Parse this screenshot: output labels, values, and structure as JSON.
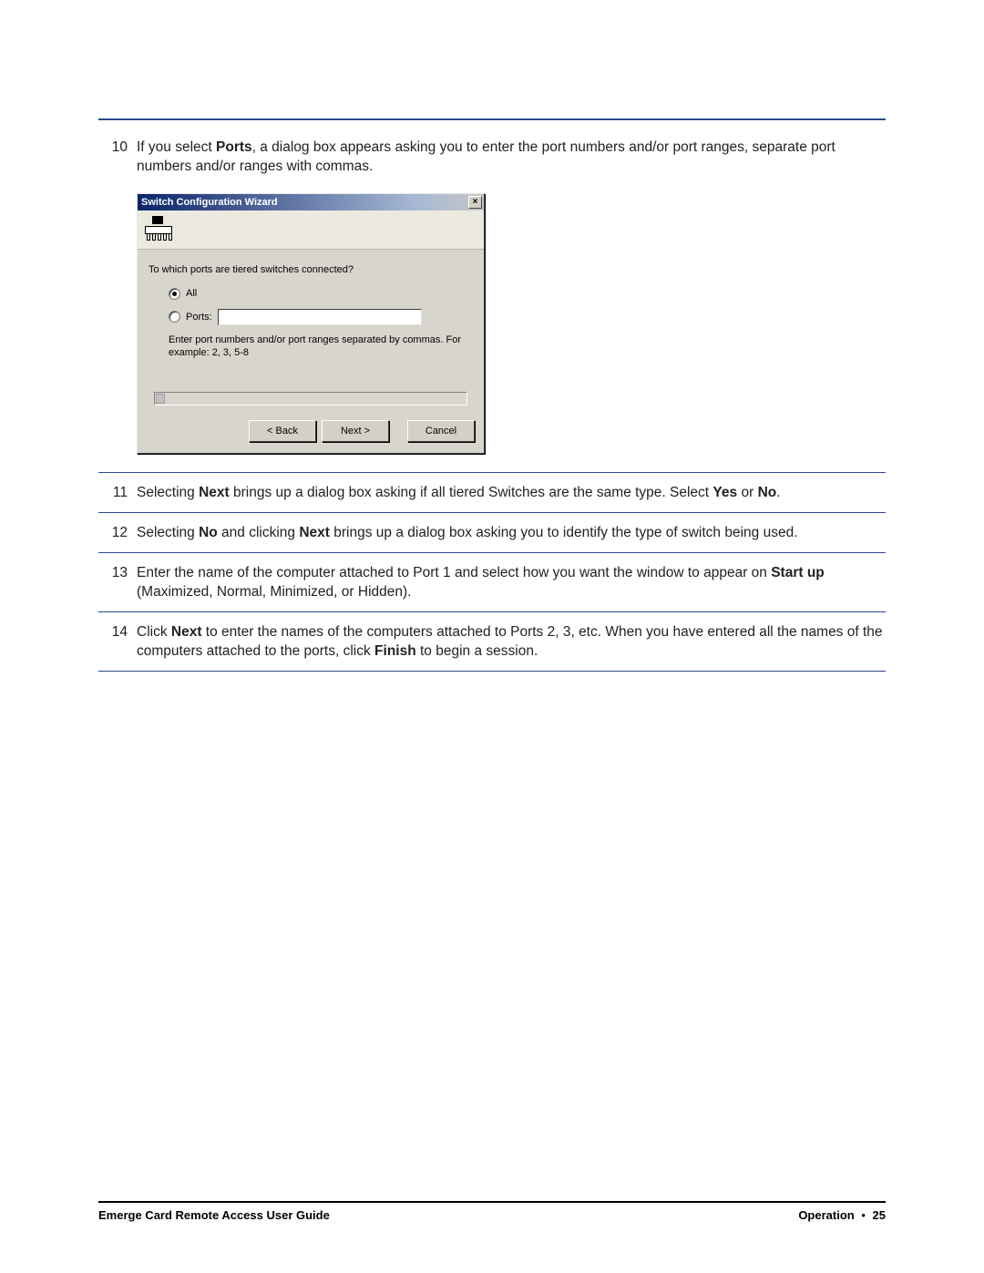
{
  "steps": {
    "s10": {
      "num": "10",
      "pre": "If you select ",
      "b1": "Ports",
      "post": ", a dialog box appears asking you to enter the port numbers and/or port ranges, separate port numbers and/or ranges with commas."
    },
    "s11": {
      "num": "11",
      "pre": "Selecting ",
      "b1": "Next",
      "mid": " brings up a dialog box asking if all tiered Switches are the same type. Select ",
      "b2": "Yes",
      "mid2": " or ",
      "b3": "No",
      "post": "."
    },
    "s12": {
      "num": "12",
      "pre": "Selecting ",
      "b1": "No",
      "mid": " and clicking ",
      "b2": "Next",
      "post": " brings up a dialog box asking you to identify the type of switch being used."
    },
    "s13": {
      "num": "13",
      "pre": "Enter the name of the computer attached to Port 1 and select how you want the window to appear on ",
      "b1": "Start up",
      "post": " (Maximized, Normal, Minimized, or Hidden)."
    },
    "s14": {
      "num": "14",
      "pre": "Click ",
      "b1": "Next",
      "mid": " to enter the names of the computers attached to Ports 2, 3, etc. When you have entered all the names of the computers attached to the ports, click ",
      "b2": "Finish",
      "post": " to begin a session."
    }
  },
  "dialog": {
    "title": "Switch Configuration Wizard",
    "close": "×",
    "prompt": "To which ports are tiered switches connected?",
    "radio_all": "All",
    "radio_ports": "Ports:",
    "hint": "Enter port numbers and/or port ranges separated by commas.  For example: 2, 3, 5-8",
    "back": "< Back",
    "next": "Next >",
    "cancel": "Cancel"
  },
  "footer": {
    "left": "Emerge Card Remote Access User Guide",
    "right_section": "Operation",
    "dot": "•",
    "page": "25"
  }
}
